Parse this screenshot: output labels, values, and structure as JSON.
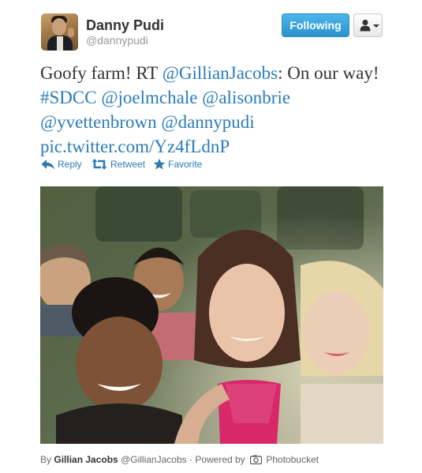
{
  "user": {
    "name": "Danny Pudi",
    "handle": "@dannypudi"
  },
  "follow_button": {
    "label": "Following"
  },
  "tweet": {
    "parts": [
      {
        "text": "Goofy farm! RT ",
        "link": false
      },
      {
        "text": "@GillianJacobs",
        "link": true
      },
      {
        "text": ": On our way! ",
        "link": false
      },
      {
        "text": "#SDCC",
        "link": true
      },
      {
        "text": " ",
        "link": false
      },
      {
        "text": "@joelmchale",
        "link": true
      },
      {
        "text": " ",
        "link": false
      },
      {
        "text": "@alisonbrie",
        "link": true
      },
      {
        "text": " ",
        "link": false
      },
      {
        "text": "@yvettenbrown",
        "link": true
      },
      {
        "text": " ",
        "link": false
      },
      {
        "text": "@dannypudi",
        "link": true
      },
      {
        "text": " ",
        "link": false
      },
      {
        "text": "pic.twitter.com/Yz4fLdnP",
        "link": true
      }
    ]
  },
  "actions": {
    "reply": "Reply",
    "retweet": "Retweet",
    "favorite": "Favorite"
  },
  "credit": {
    "by": "By",
    "author_name": "Gillian Jacobs",
    "author_handle": "@GillianJacobs",
    "powered_by": "· Powered by",
    "service": "Photobucket"
  },
  "icons": {
    "reply": "reply-arrow-icon",
    "retweet": "retweet-icon",
    "favorite": "star-icon",
    "user_menu": "person-icon",
    "photobucket": "camera-icon"
  },
  "colors": {
    "link": "#2b7bb9",
    "follow_button": "#2a91cd",
    "name": "#333333",
    "handle": "#999999"
  }
}
